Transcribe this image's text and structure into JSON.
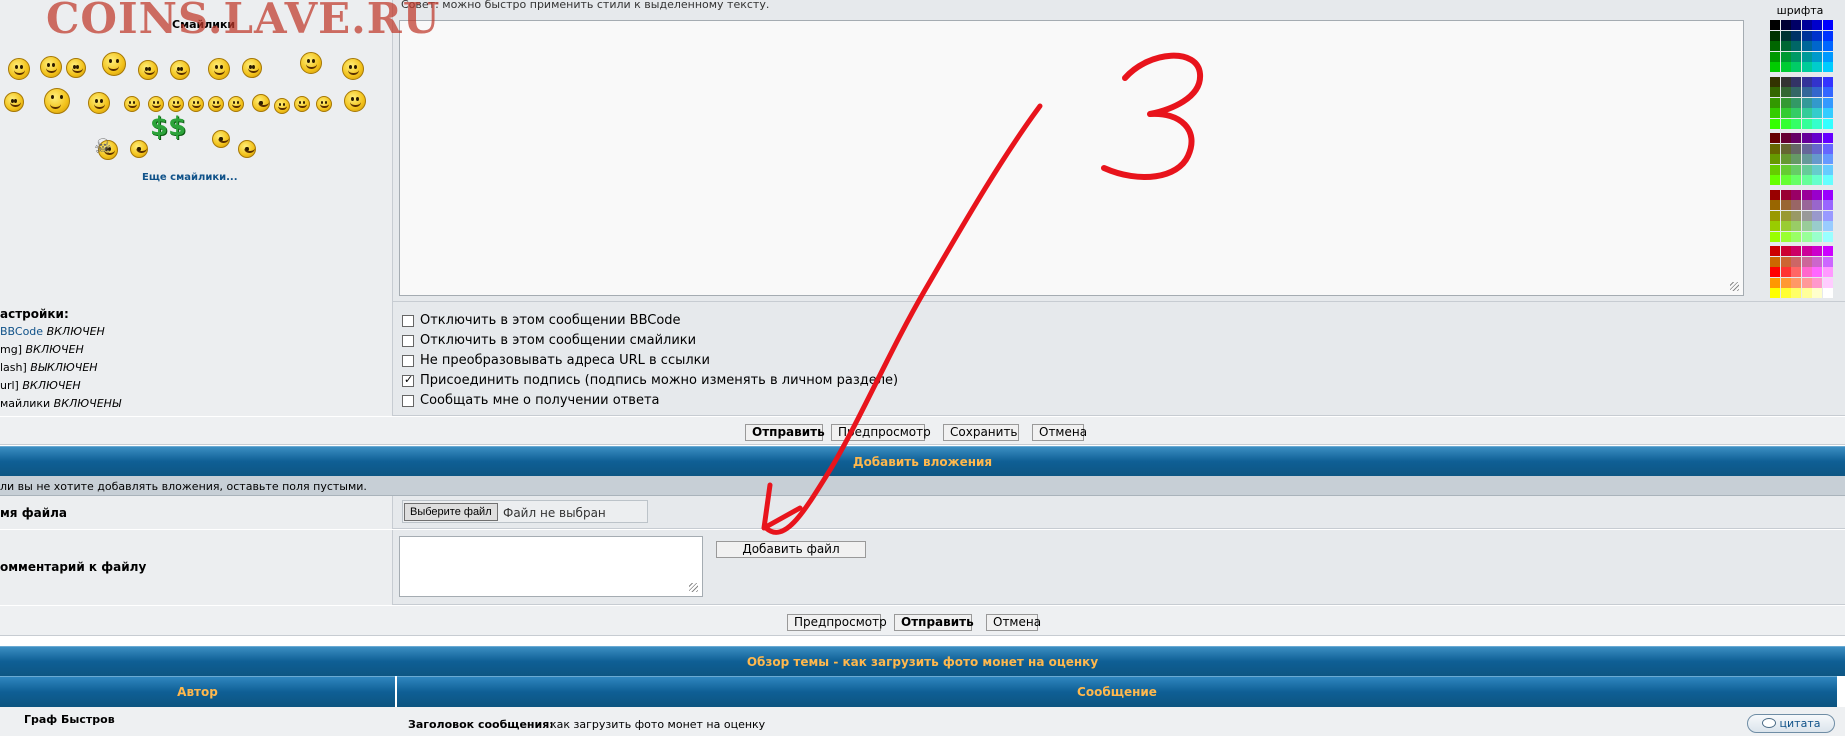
{
  "watermark": "COINS.LAVE.RU",
  "smilies": {
    "title": "Смайлики",
    "more_link": "Еще смайлики..."
  },
  "editor": {
    "hint": "Совет: можно быстро применить стили к выделенному тексту.",
    "font_color_label": "шрифта"
  },
  "settings": {
    "title": "астройки:",
    "lines": [
      {
        "key": "BBCode",
        "value": "ВКЛЮЧЕН"
      },
      {
        "key": "mg]",
        "value": "ВКЛЮЧЕН"
      },
      {
        "key": "lash]",
        "value": "ВЫКЛЮЧЕН"
      },
      {
        "key": "url]",
        "value": "ВКЛЮЧЕН"
      },
      {
        "key": "майлики",
        "value": "ВКЛЮЧЕНЫ"
      }
    ]
  },
  "options": [
    {
      "label": "Отключить в этом сообщении BBCode",
      "checked": false
    },
    {
      "label": "Отключить в этом сообщении смайлики",
      "checked": false
    },
    {
      "label": "Не преобразовывать адреса URL в ссылки",
      "checked": false
    },
    {
      "label": "Присоединить подпись (подпись можно изменять в личном разделе)",
      "checked": true
    },
    {
      "label": "Сообщать мне о получении ответа",
      "checked": false
    }
  ],
  "buttons_top": {
    "submit": "Отправить",
    "preview": "Предпросмотр",
    "save": "Сохранить",
    "cancel": "Отмена"
  },
  "attachments": {
    "header": "Добавить вложения",
    "note": "ли вы не хотите добавлять вложения, оставьте поля пустыми.",
    "file_label": "мя файла",
    "choose_button": "Выберите файл",
    "no_file": "Файл не выбран",
    "comment_label": "омментарий к файлу",
    "add_file_button": "Добавить файл"
  },
  "buttons_bottom": {
    "preview": "Предпросмотр",
    "submit": "Отправить",
    "cancel": "Отмена"
  },
  "topic_review": {
    "header": "Обзор темы - как загрузить фото монет на оценку",
    "col_author": "Автор",
    "col_message": "Сообщение",
    "author": "Граф Быстров",
    "subject_label": "Заголовок сообщения:",
    "subject_value": "как загрузить фото монет на оценку",
    "quote_button": "цитата"
  },
  "annotation": {
    "number": "3",
    "color": "#e8141c"
  },
  "colors": {
    "header_bar": "#0f5f95",
    "header_text": "#ffb84d",
    "link": "#105289"
  }
}
